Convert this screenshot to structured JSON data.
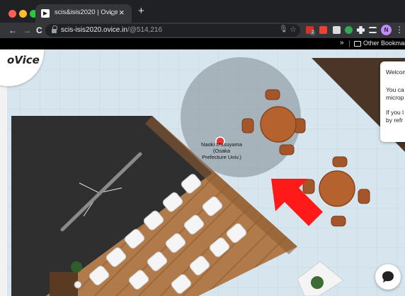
{
  "browser": {
    "tab": {
      "title": "scis&isis2020 | Ovice",
      "close_glyph": "×"
    },
    "new_tab_glyph": "+",
    "nav": {
      "back": "←",
      "forward": "→",
      "reload": "C"
    },
    "url": {
      "host": "scis-isis2020.ovice.in",
      "path": "/@514,216"
    },
    "extensions": {
      "badge_count": "2",
      "profile_initial": "N"
    },
    "bookmarks": {
      "overflow_glyph": "»",
      "other_label": "Other Bookmarks"
    }
  },
  "app": {
    "logo": "oVice",
    "avatar": {
      "name_lines": [
        "Naoki Masuyama",
        "(Osaka",
        "Prefecture Univ.)"
      ]
    },
    "welcome_panel": {
      "lines": [
        "Welcom",
        "You ca",
        "microp",
        "If you l",
        "by refr"
      ]
    },
    "colors": {
      "floor": "#d7e6ee",
      "wood": "#b07a4a",
      "dark_stage": "#2f2f2f",
      "table": "#b5622e",
      "arrow": "#ff1a1a",
      "proximity_circle": "#808891"
    }
  }
}
